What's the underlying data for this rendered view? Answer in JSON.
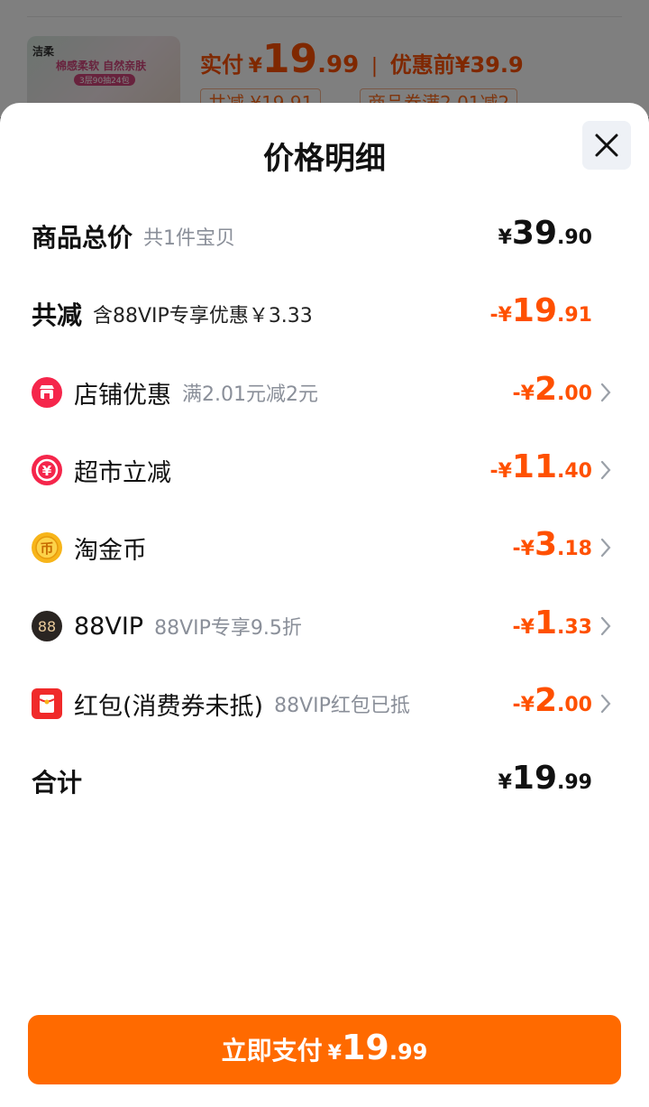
{
  "background": {
    "thumb_brand": "洁柔",
    "thumb_slogan": "棉感柔软 自然亲肤",
    "thumb_tag": "3层90抽24包",
    "price_label": "实付",
    "price_currency": "¥",
    "price_int": "19",
    "price_dec": ".99",
    "before_label": "优惠前",
    "before_price": "¥39.9",
    "tag1": "共减 ¥19.91",
    "tag2": "商品券满2.01减2"
  },
  "sheet": {
    "title": "价格明细",
    "close_icon": "close-icon",
    "rows": [
      {
        "label": "商品总价",
        "sub": "共1件宝贝",
        "currency": "¥",
        "int": "39",
        "dec": ".90"
      },
      {
        "label": "共减",
        "sub": "含88VIP专享优惠￥3.33",
        "currency": "-¥",
        "int": "19",
        "dec": ".91"
      },
      {
        "icon": "shop-icon",
        "label": "店铺优惠",
        "sub": "满2.01元减2元",
        "currency": "-¥",
        "int": "2",
        "dec": ".00"
      },
      {
        "icon": "market-yen-icon",
        "label": "超市立减",
        "sub": "",
        "currency": "-¥",
        "int": "11",
        "dec": ".40"
      },
      {
        "icon": "coin-icon",
        "label": "淘金币",
        "sub": "",
        "currency": "-¥",
        "int": "3",
        "dec": ".18"
      },
      {
        "icon": "vip-88-icon",
        "label": "88VIP",
        "sub": "88VIP专享9.5折",
        "currency": "-¥",
        "int": "1",
        "dec": ".33"
      },
      {
        "icon": "red-packet-icon",
        "label": "红包(消费券未抵)",
        "sub": "88VIP红包已抵",
        "currency": "-¥",
        "int": "2",
        "dec": ".00"
      },
      {
        "label": "合计",
        "sub": "",
        "currency": "¥",
        "int": "19",
        "dec": ".99"
      }
    ],
    "icon_glyphs": {
      "market": "¥",
      "coin": "币",
      "vip": "88"
    }
  },
  "pay_button": {
    "label": "立即支付",
    "currency": "¥",
    "int": "19",
    "dec": ".99"
  },
  "colors": {
    "accent": "#ff5000",
    "button": "#ff6a00",
    "text": "#111111",
    "muted": "#8a8f99"
  }
}
